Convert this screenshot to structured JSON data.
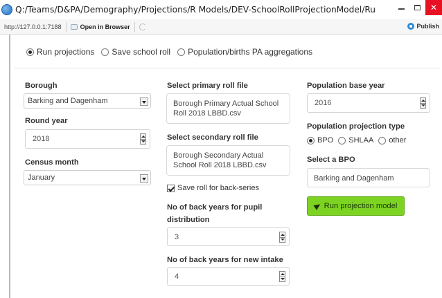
{
  "window": {
    "title": "Q:/Teams/D&PA/Demography/Projections/R Models/DEV-SchoolRollProjectionModel/RunSRP - S...",
    "url": "http://127.0.0.1:7188",
    "open_in_browser": "Open in Browser",
    "publish": "Publish"
  },
  "mode": {
    "options": [
      "Run projections",
      "Save school roll",
      "Population/births PA aggregations"
    ],
    "selected": "Run projections"
  },
  "col1": {
    "borough_label": "Borough",
    "borough_value": "Barking and Dagenham",
    "round_year_label": "Round year",
    "round_year_value": "2018",
    "census_month_label": "Census month",
    "census_month_value": "January"
  },
  "col2": {
    "primary_label": "Select primary roll file",
    "primary_line1": "Borough Primary Actual School",
    "primary_line2": "Roll 2018 LBBD.csv",
    "secondary_label": "Select secondary roll file",
    "secondary_line1": "Borough Secondary Actual",
    "secondary_line2": "School Roll 2018 LBBD.csv",
    "save_roll_label": "Save roll for back-series",
    "save_roll_checked": true,
    "back_years_pupil_label_1": "No of back years for pupil",
    "back_years_pupil_label_2": "distribution",
    "back_years_pupil_value": "3",
    "back_years_intake_label": "No of back years for new intake",
    "back_years_intake_value": "4"
  },
  "col3": {
    "pop_base_year_label": "Population base year",
    "pop_base_year_value": "2016",
    "projection_type_label": "Population projection type",
    "projection_type_options": [
      "BPO",
      "SHLAA",
      "other"
    ],
    "projection_type_selected": "BPO",
    "bpo_label": "Select a BPO",
    "bpo_value": "Barking and Dagenham",
    "run_button": "Run projection model",
    "run_button_color": "#7dd321"
  }
}
